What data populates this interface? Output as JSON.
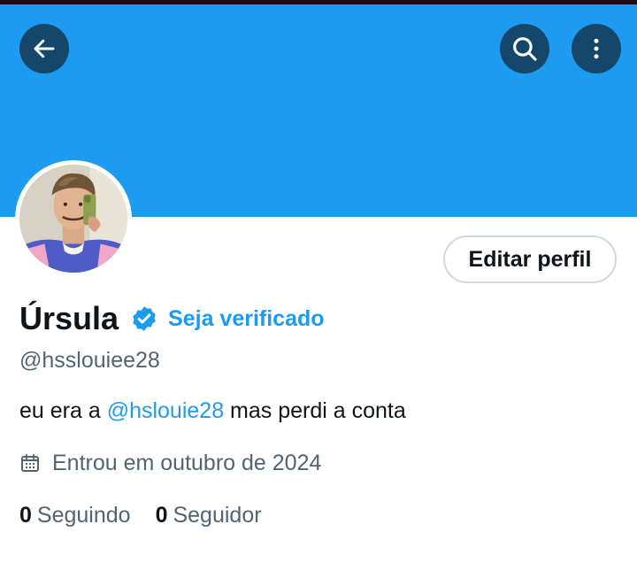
{
  "header": {
    "banner_color": "#1d9bf0"
  },
  "profile": {
    "display_name": "Úrsula",
    "verified_badge": "verified-badge-icon",
    "get_verified_label": "Seja verificado",
    "handle": "@hsslouiee28",
    "bio": {
      "prefix": "eu era a ",
      "mention": "@hslouie28",
      "suffix": " mas perdi a conta"
    },
    "joined_text": "Entrou em outubro de 2024",
    "following_count": "0",
    "following_label": "Seguindo",
    "followers_count": "0",
    "followers_label": "Seguidor"
  },
  "actions": {
    "edit_profile_label": "Editar perfil"
  },
  "icons": {
    "back": "arrow-left-icon",
    "search": "search-icon",
    "more": "more-vertical-icon",
    "calendar": "calendar-icon"
  },
  "colors": {
    "accent": "#1d9bf0",
    "text_primary": "#0f1419",
    "text_secondary": "#536471",
    "border": "#cfd9de"
  }
}
